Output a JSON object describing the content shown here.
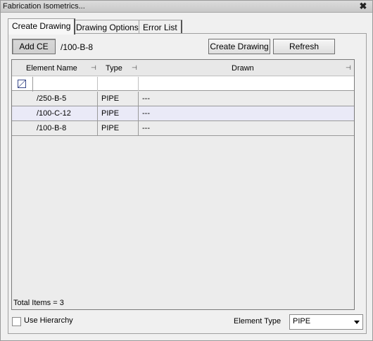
{
  "window": {
    "title": "Fabrication Isometrics...",
    "close_glyph": "✖"
  },
  "tabs": [
    {
      "label": "Create Drawing",
      "active": true
    },
    {
      "label": "Drawing Options",
      "active": false
    },
    {
      "label": "Error List",
      "active": false
    }
  ],
  "toolbar": {
    "add_ce_label": "Add CE",
    "current_element": "/100-B-8",
    "create_drawing_label": "Create Drawing",
    "refresh_label": "Refresh"
  },
  "grid": {
    "columns": [
      {
        "label": "Element Name"
      },
      {
        "label": "Type"
      },
      {
        "label": "Drawn"
      }
    ],
    "rows": [
      {
        "name": "/250-B-5",
        "type": "PIPE",
        "drawn": "---",
        "current": true
      },
      {
        "name": "/100-C-12",
        "type": "PIPE",
        "drawn": "---",
        "current": false
      },
      {
        "name": "/100-B-8",
        "type": "PIPE",
        "drawn": "---",
        "current": false
      }
    ],
    "total_items": "Total Items = 3"
  },
  "footer": {
    "use_hierarchy_label": "Use Hierarchy",
    "use_hierarchy_checked": false,
    "element_type_label": "Element Type",
    "element_type_value": "PIPE"
  },
  "icons": {
    "pin": "pin-icon",
    "filter": "filter-icon",
    "row_indicator": "row-arrow-icon",
    "dropdown": "chevron-down-icon",
    "close": "close-icon"
  }
}
